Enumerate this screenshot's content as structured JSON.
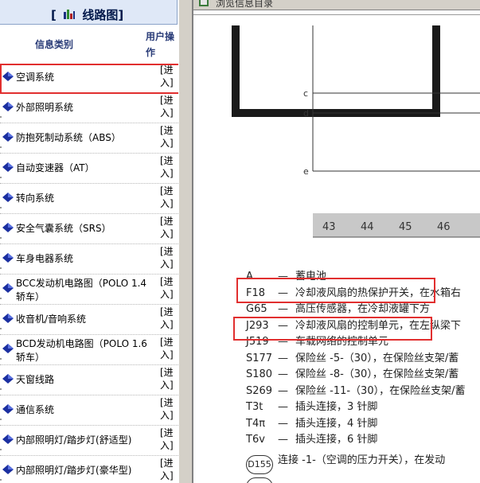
{
  "left_panel": {
    "title": "线路图",
    "bracket_open": "[",
    "bracket_close": "]",
    "col_category": "信息类别",
    "col_operation": "用户操作",
    "enter_label": "[进入]",
    "items": [
      {
        "label": "空调系统"
      },
      {
        "label": "外部照明系统"
      },
      {
        "label": "防抱死制动系统（ABS）"
      },
      {
        "label": "自动变速器（AT）"
      },
      {
        "label": "转向系统"
      },
      {
        "label": "安全气囊系统（SRS）"
      },
      {
        "label": "车身电器系统"
      },
      {
        "label": "BCC发动机电路图（POLO 1.4轿车）"
      },
      {
        "label": "收音机/音响系统"
      },
      {
        "label": "BCD发动机电路图（POLO 1.6轿车）"
      },
      {
        "label": "天窗线路"
      },
      {
        "label": "通信系统"
      },
      {
        "label": "内部照明灯/踏步灯(舒适型)"
      },
      {
        "label": "内部照明灯/踏步灯(豪华型)"
      }
    ]
  },
  "right_panel": {
    "title": "浏览信息目录",
    "wire_labels": [
      "c",
      "d",
      "e"
    ],
    "ruler_numbers": [
      "43",
      "44",
      "45",
      "46"
    ],
    "legend": [
      {
        "code": "A",
        "dash": "—",
        "text": "蓄电池"
      },
      {
        "code": "F18",
        "dash": "—",
        "text": "冷却液风扇的热保护开关，在水箱右"
      },
      {
        "code": "G65",
        "dash": "—",
        "text": "高压传感器，在冷却液罐下方"
      },
      {
        "code": "J293",
        "dash": "—",
        "text": "冷却液风扇的控制单元，在左纵梁下"
      },
      {
        "code": "J519",
        "dash": "—",
        "text": "车载网络的控制单元"
      },
      {
        "code": "S177",
        "dash": "—",
        "text": "保险丝 -5-（30），在保险丝支架/蓄"
      },
      {
        "code": "S180",
        "dash": "—",
        "text": "保险丝 -8-（30），在保险丝支架/蓄"
      },
      {
        "code": "S269",
        "dash": "—",
        "text": "保险丝 -11-（30），在保险丝支架/蓄"
      },
      {
        "code": "T3t",
        "dash": "—",
        "text": "插头连接，3 针脚"
      },
      {
        "code": "T4π",
        "dash": "—",
        "text": "插头连接，4 针脚"
      },
      {
        "code": "T6v",
        "dash": "—",
        "text": "插头连接，6 针脚"
      },
      {
        "code": "",
        "dash": "—",
        "text": "连接 -1-（空调的压力开关），在发动"
      }
    ],
    "badge_label": "D155"
  },
  "colors": {
    "highlight": "#e12f2f",
    "header_bg": "#dfe8f7",
    "title_color": "#00184a",
    "ruler_bg": "#c8c8c8"
  }
}
